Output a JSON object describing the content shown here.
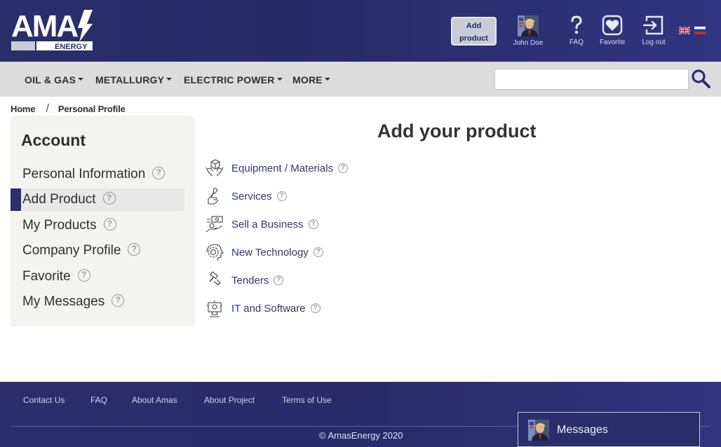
{
  "header": {
    "logo_main": "AMA",
    "logo_sub": "ENERGY",
    "add_product_line1": "Add",
    "add_product_line2": "product",
    "user_name": "John Doe",
    "faq_label": "FAQ",
    "favorite_label": "Favorite",
    "logout_label": "Log out",
    "languages": [
      "en-flag-icon",
      "ru-flag-icon"
    ]
  },
  "nav": {
    "items": [
      {
        "label": "OIL & GAS"
      },
      {
        "label": "METALLURGY"
      },
      {
        "label": "ELECTRIC POWER"
      },
      {
        "label": "MORE"
      }
    ],
    "search_placeholder": "",
    "search_value": ""
  },
  "breadcrumb": {
    "home": "Home",
    "separator": "/",
    "current": "Personal Profile"
  },
  "sidebar": {
    "title": "Account",
    "items": [
      {
        "label": "Personal Information",
        "active": false
      },
      {
        "label": "Add Product",
        "active": true
      },
      {
        "label": "My Products",
        "active": false
      },
      {
        "label": "Company Profile",
        "active": false
      },
      {
        "label": "Favorite",
        "active": false
      },
      {
        "label": "My Messages",
        "active": false
      }
    ],
    "help_glyph": "?"
  },
  "main": {
    "title": "Add your product",
    "categories": [
      {
        "label": "Equipment / Materials",
        "icon": "box-hands-icon"
      },
      {
        "label": "Services",
        "icon": "wrench-hand-icon"
      },
      {
        "label": "Sell a Business",
        "icon": "money-hand-icon"
      },
      {
        "label": "New Technology",
        "icon": "gear-head-icon"
      },
      {
        "label": "Tenders",
        "icon": "gavel-icon"
      },
      {
        "label": "IT and Software",
        "icon": "computer-icon"
      }
    ]
  },
  "footer": {
    "links": [
      "Contact Us",
      "FAQ",
      "About Amas",
      "About Project",
      "Terms of Use"
    ],
    "copyright": "© AmasEnergy 2020",
    "messages_label": "Messages"
  },
  "colors": {
    "brand_navy": "#2a2f6b",
    "nav_gray": "#dcdcdc",
    "sidebar_bg": "#f3f3ef",
    "link_blue": "#2f3a66"
  }
}
